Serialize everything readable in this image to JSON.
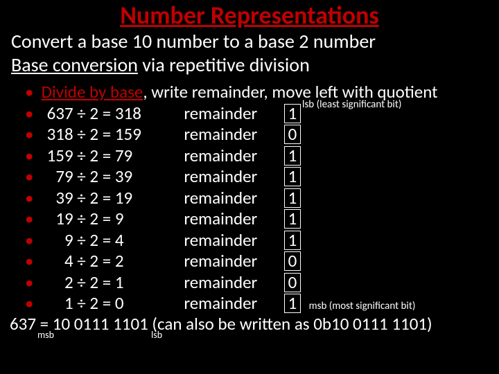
{
  "title": "Number Representations",
  "subtitle1": "Convert a base 10 number to a base 2 number",
  "subtitle2_a": "Base conversion",
  "subtitle2_b": " via repetitive division",
  "lead_a": "Divide by base",
  "lead_b": ", write remainder, move left with quotient",
  "lsb_note": "lsb (least significant bit)",
  "msb_note": "msb (most significant bit)",
  "rows": [
    {
      "dividend": "637",
      "divisor": "2",
      "quotient": "318",
      "rem": "1"
    },
    {
      "dividend": "318",
      "divisor": "2",
      "quotient": "159",
      "rem": "0"
    },
    {
      "dividend": "159",
      "divisor": "2",
      "quotient": "79",
      "rem": "1"
    },
    {
      "dividend": "79",
      "divisor": "2",
      "quotient": "39",
      "rem": "1"
    },
    {
      "dividend": "39",
      "divisor": "2",
      "quotient": "19",
      "rem": "1"
    },
    {
      "dividend": "19",
      "divisor": "2",
      "quotient": "9",
      "rem": "1"
    },
    {
      "dividend": "9",
      "divisor": "2",
      "quotient": "4",
      "rem": "1"
    },
    {
      "dividend": "4",
      "divisor": "2",
      "quotient": "2",
      "rem": "0"
    },
    {
      "dividend": "2",
      "divisor": "2",
      "quotient": "1",
      "rem": "0"
    },
    {
      "dividend": "1",
      "divisor": "2",
      "quotient": "0",
      "rem": "1"
    }
  ],
  "remword": "remainder",
  "final": "637 = 10 0111 1101 (can also be written as 0b10 0111 1101)",
  "sub_msb": "msb",
  "sub_lsb": "lsb"
}
